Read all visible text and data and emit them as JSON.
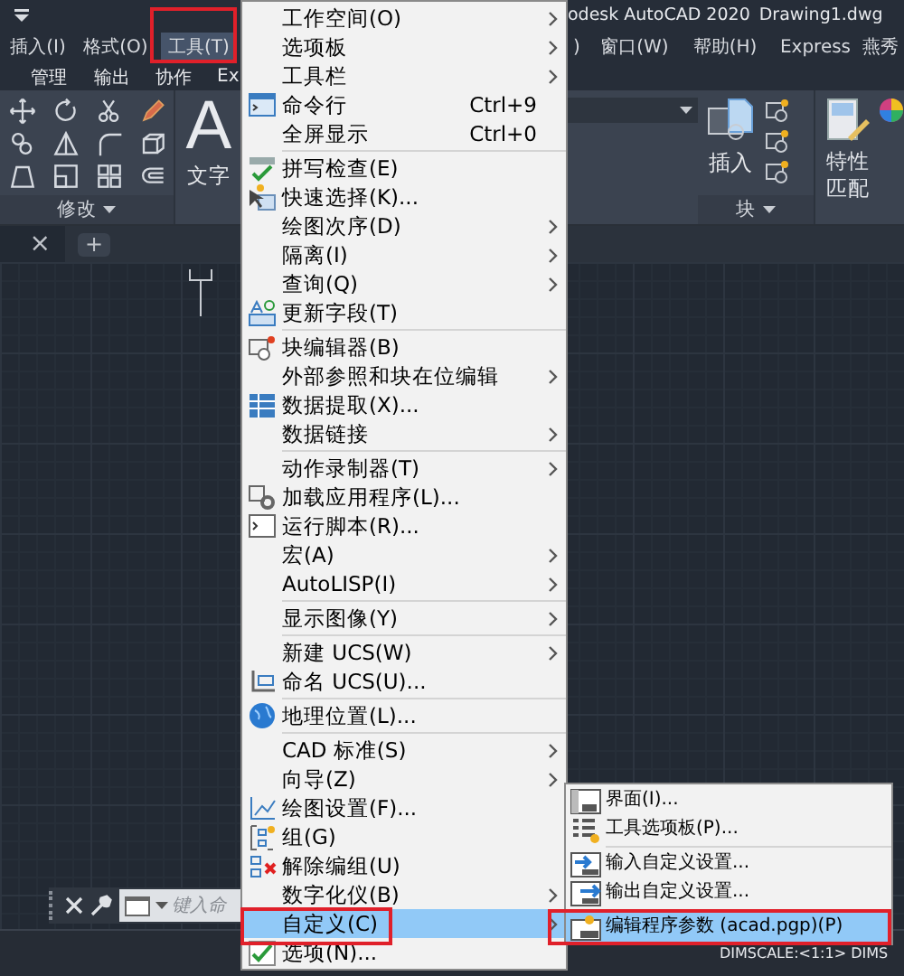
{
  "title_bar": {
    "title": "odesk AutoCAD 2020",
    "document": "Drawing1.dwg"
  },
  "menu_bar": [
    {
      "label": "插入(I)",
      "selected": false
    },
    {
      "label": "格式(O)",
      "selected": false
    },
    {
      "label": "工具(T)",
      "selected": true
    },
    {
      "label": ")",
      "selected": false
    },
    {
      "label": "窗口(W)",
      "selected": false
    },
    {
      "label": "帮助(H)",
      "selected": false
    },
    {
      "label": "Express",
      "selected": false
    },
    {
      "label": "燕秀",
      "selected": false
    }
  ],
  "ribbon_tabs": [
    "管理",
    "输出",
    "协作",
    "Ex"
  ],
  "ribbon": {
    "modify_label": "修改",
    "text_tool": {
      "glyph": "A",
      "label": "文字"
    },
    "insert_label": "插入",
    "block_label": "块",
    "match_label": "特性匹配"
  },
  "file_tabs": {
    "close": "×",
    "add": "+"
  },
  "command_line": {
    "placeholder": "键入命"
  },
  "status_bar": {
    "text": "DIMSCALE:<1:1>  DIMS"
  },
  "menu": {
    "items": [
      {
        "kind": "item",
        "label": "工作空间(O)",
        "submenu": true,
        "selected": false
      },
      {
        "kind": "item",
        "label": "选项板",
        "submenu": true,
        "selected": false
      },
      {
        "kind": "item",
        "label": "工具栏",
        "submenu": true,
        "selected": false
      },
      {
        "kind": "item",
        "label": "命令行",
        "shortcut": "Ctrl+9",
        "selected": false
      },
      {
        "kind": "item",
        "label": "全屏显示",
        "shortcut": "Ctrl+0",
        "selected": false
      },
      {
        "kind": "separator"
      },
      {
        "kind": "item",
        "label": "拼写检查(E)",
        "selected": false
      },
      {
        "kind": "item",
        "label": "快速选择(K)...",
        "selected": false
      },
      {
        "kind": "item",
        "label": "绘图次序(D)",
        "submenu": true,
        "selected": false
      },
      {
        "kind": "item",
        "label": "隔离(I)",
        "submenu": true,
        "selected": false
      },
      {
        "kind": "item",
        "label": "查询(Q)",
        "submenu": true,
        "selected": false
      },
      {
        "kind": "item",
        "label": "更新字段(T)",
        "selected": false
      },
      {
        "kind": "separator"
      },
      {
        "kind": "item",
        "label": "块编辑器(B)",
        "selected": false
      },
      {
        "kind": "item",
        "label": "外部参照和块在位编辑",
        "submenu": true,
        "selected": false
      },
      {
        "kind": "item",
        "label": "数据提取(X)...",
        "selected": false
      },
      {
        "kind": "item",
        "label": "数据链接",
        "submenu": true,
        "selected": false
      },
      {
        "kind": "separator"
      },
      {
        "kind": "item",
        "label": "动作录制器(T)",
        "submenu": true,
        "selected": false
      },
      {
        "kind": "item",
        "label": "加载应用程序(L)...",
        "selected": false
      },
      {
        "kind": "item",
        "label": "运行脚本(R)...",
        "selected": false
      },
      {
        "kind": "item",
        "label": "宏(A)",
        "submenu": true,
        "selected": false
      },
      {
        "kind": "item",
        "label": "AutoLISP(I)",
        "submenu": true,
        "selected": false
      },
      {
        "kind": "separator"
      },
      {
        "kind": "item",
        "label": "显示图像(Y)",
        "submenu": true,
        "selected": false
      },
      {
        "kind": "separator"
      },
      {
        "kind": "item",
        "label": "新建 UCS(W)",
        "submenu": true,
        "selected": false
      },
      {
        "kind": "item",
        "label": "命名 UCS(U)...",
        "selected": false
      },
      {
        "kind": "separator"
      },
      {
        "kind": "item",
        "label": "地理位置(L)...",
        "selected": false
      },
      {
        "kind": "separator"
      },
      {
        "kind": "item",
        "label": "CAD 标准(S)",
        "submenu": true,
        "selected": false
      },
      {
        "kind": "item",
        "label": "向导(Z)",
        "submenu": true,
        "selected": false
      },
      {
        "kind": "item",
        "label": "绘图设置(F)...",
        "selected": false
      },
      {
        "kind": "item",
        "label": "组(G)",
        "selected": false
      },
      {
        "kind": "item",
        "label": "解除编组(U)",
        "selected": false
      },
      {
        "kind": "item",
        "label": "数字化仪(B)",
        "submenu": true,
        "selected": false
      },
      {
        "kind": "item",
        "label": "自定义(C)",
        "submenu": true,
        "selected": true
      },
      {
        "kind": "item",
        "label": "选项(N)...",
        "selected": false
      }
    ]
  },
  "submenu": {
    "items": [
      {
        "kind": "item",
        "label": "界面(I)...",
        "selected": false
      },
      {
        "kind": "item",
        "label": "工具选项板(P)...",
        "selected": false
      },
      {
        "kind": "separator"
      },
      {
        "kind": "item",
        "label": "输入自定义设置...",
        "selected": false
      },
      {
        "kind": "item",
        "label": "输出自定义设置...",
        "selected": false
      },
      {
        "kind": "separator"
      },
      {
        "kind": "item",
        "label": "编辑程序参数 (acad.pgp)(P)",
        "selected": true
      }
    ]
  }
}
